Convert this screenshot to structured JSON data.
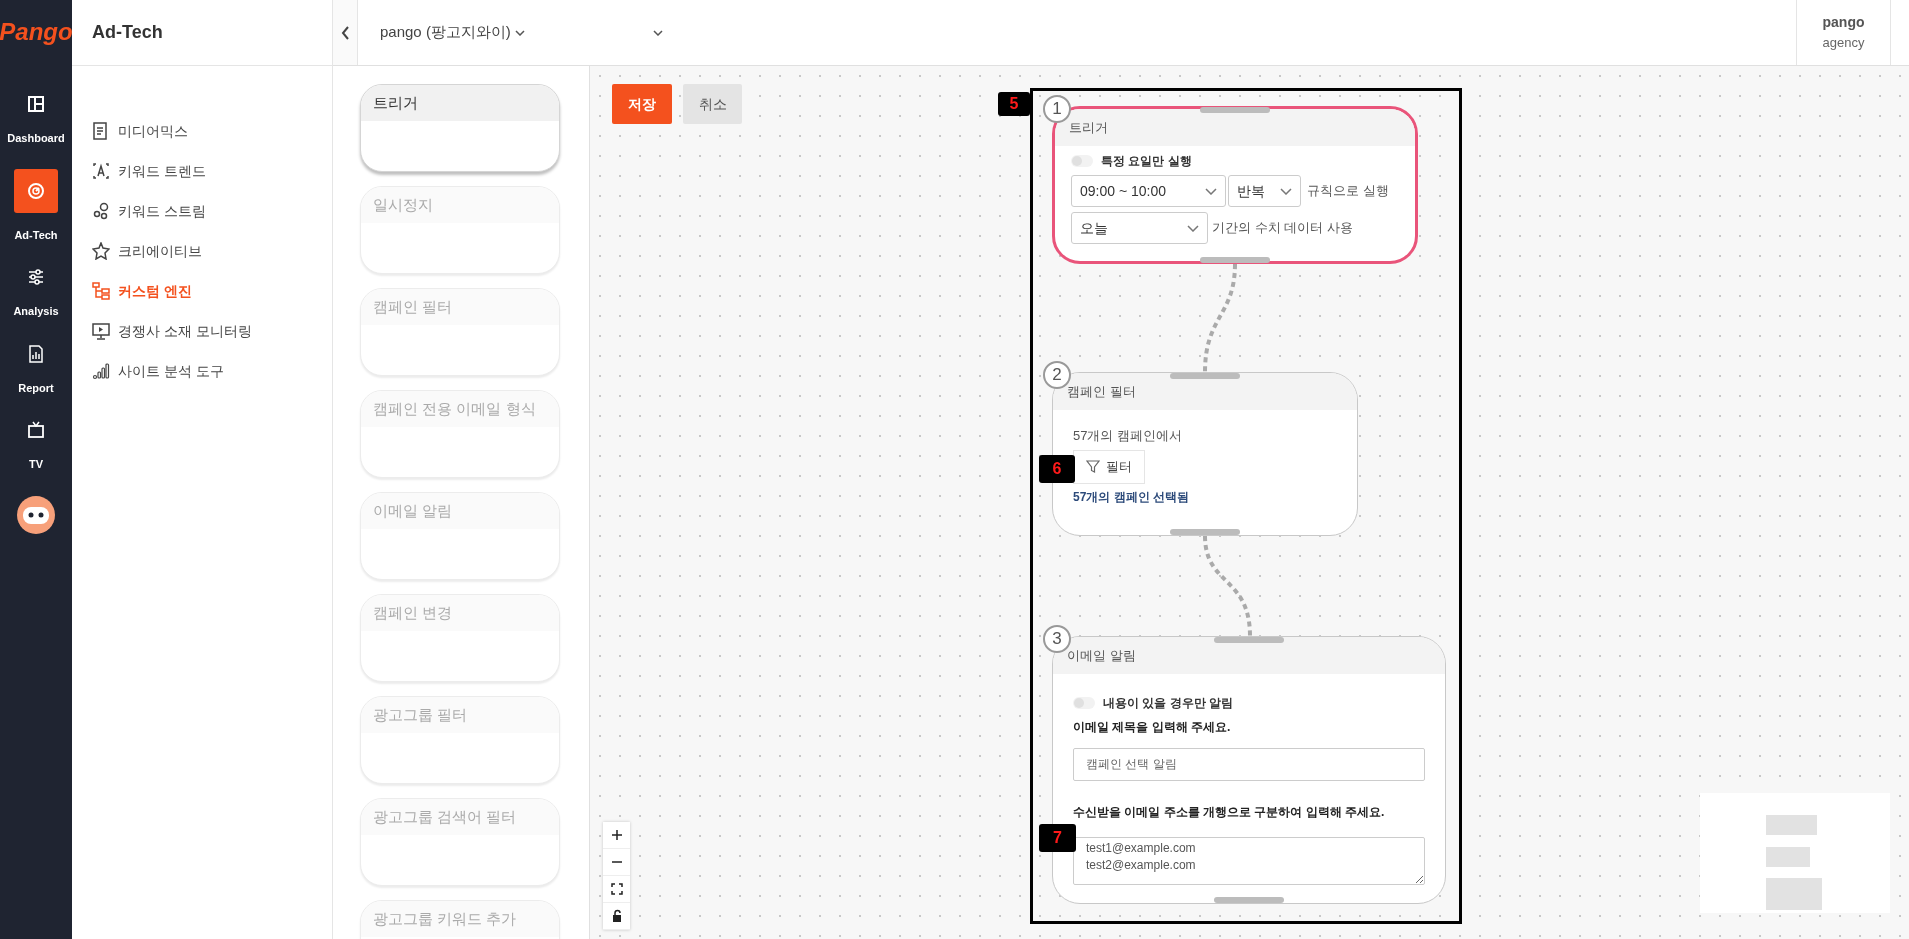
{
  "rail": {
    "logo": "Pango",
    "items": [
      {
        "label": "Dashboard",
        "kind": "dashboard",
        "selected": false
      },
      {
        "label": "Ad-Tech",
        "kind": "adtech",
        "selected": true
      },
      {
        "label": "Analysis",
        "kind": "analysis",
        "selected": false
      },
      {
        "label": "Report",
        "kind": "report",
        "selected": false
      },
      {
        "label": "TV",
        "kind": "tv",
        "selected": false
      }
    ]
  },
  "menu": {
    "title": "Ad-Tech",
    "items": [
      {
        "label": "미디어믹스",
        "kind": "doc",
        "selected": false
      },
      {
        "label": "키워드 트렌드",
        "kind": "trend",
        "selected": false
      },
      {
        "label": "키워드 스트림",
        "kind": "stream",
        "selected": false
      },
      {
        "label": "크리에이티브",
        "kind": "creative",
        "selected": false
      },
      {
        "label": "커스텀 엔진",
        "kind": "engine",
        "selected": true
      },
      {
        "label": "경쟁사 소재 모니터링",
        "kind": "monitor",
        "selected": false
      },
      {
        "label": "사이트 분석 도구",
        "kind": "chart",
        "selected": false
      }
    ]
  },
  "topbar": {
    "account": "pango (팡고지와이)",
    "user": {
      "name": "pango",
      "role": "agency"
    }
  },
  "palette": [
    {
      "label": "트리거",
      "enabled": true
    },
    {
      "label": "일시정지",
      "enabled": false
    },
    {
      "label": "캠페인 필터",
      "enabled": false
    },
    {
      "label": "캠페인 전용 이메일 형식",
      "enabled": false
    },
    {
      "label": "이메일 알림",
      "enabled": false
    },
    {
      "label": "캠페인 변경",
      "enabled": false
    },
    {
      "label": "광고그룹 필터",
      "enabled": false
    },
    {
      "label": "광고그룹 검색어 필터",
      "enabled": false
    },
    {
      "label": "광고그룹 키워드 추가",
      "enabled": false
    }
  ],
  "toolbar": {
    "save": "저장",
    "cancel": "취소"
  },
  "nodes": [
    {
      "kind": "trigger",
      "number": "1",
      "title": "트리거",
      "selected": true,
      "toggle": {
        "label": "특정 요일만 실행",
        "on": false
      },
      "time": "09:00 ~ 10:00",
      "repeat": "반복",
      "repeat_suffix": "규칙으로 실행",
      "period": "오늘",
      "period_suffix": "기간의 수치 데이터 사용"
    },
    {
      "kind": "filter",
      "number": "2",
      "title": "캠페인 필터",
      "selected": false,
      "source": "57개의 캠페인에서",
      "button": "필터",
      "result": "57개의 캠페인 선택됨"
    },
    {
      "kind": "email",
      "number": "3",
      "title": "이메일 알림",
      "selected": false,
      "toggle": {
        "label": "내용이 있을 경우만 알림",
        "on": false
      },
      "subject_label": "이메일 제목을 입력해 주세요.",
      "subject": "캠페인 선택 알림",
      "recipients_label": "수신받을 이메일 주소를 개행으로 구분하여 입력해 주세요.",
      "recipients": "test1@example.com\ntest2@example.com"
    }
  ],
  "annotations": [
    {
      "label": "5"
    },
    {
      "label": "6"
    },
    {
      "label": "7"
    }
  ]
}
